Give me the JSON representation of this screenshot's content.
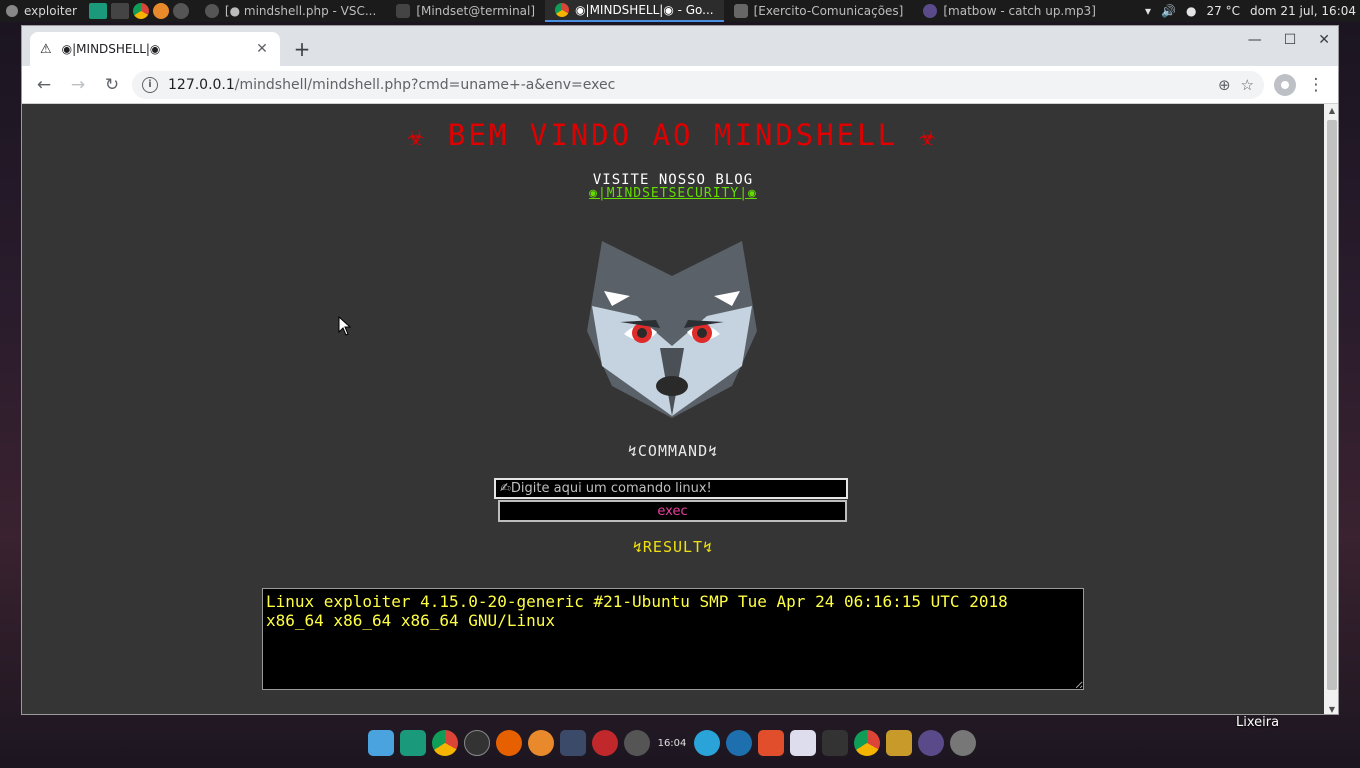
{
  "topbar": {
    "app_name": "exploiter",
    "tasks": [
      {
        "label": "[● mindshell.php - VSC...",
        "active": false
      },
      {
        "label": "[Mindset@terminal]",
        "active": false
      },
      {
        "label": "◉|MINDSHELL|◉ - Go...",
        "active": true
      },
      {
        "label": "[Exercito-Comunicações]",
        "active": false
      },
      {
        "label": "[matbow - catch up.mp3]",
        "active": false
      }
    ],
    "temperature": "27 °C",
    "datetime": "dom 21 jul, 16:04"
  },
  "browser": {
    "tab_title": "◉|MINDSHELL|◉",
    "url_host": "127.0.0.1",
    "url_rest": "/mindshell/mindshell.php?cmd=uname+-a&env=exec"
  },
  "page": {
    "heading": "☣ BEM VINDO AO MINDSHELL ☣",
    "blog_label": "VISITE NOSSO BLOG",
    "blog_link": "◉|MINDSETSECURITY|◉",
    "command_label": "↯COMMAND↯",
    "command_placeholder": "✍Digite aqui um comando linux!",
    "exec_label": "exec",
    "result_label": "↯RESULT↯",
    "result_output": "Linux exploiter 4.15.0-20-generic #21-Ubuntu SMP Tue Apr 24 06:16:15 UTC 2018\nx86_64 x86_64 x86_64 GNU/Linux"
  },
  "desktop": {
    "trash_label": "Lixeira",
    "dock_clock": "16:04"
  },
  "colors": {
    "heading": "#e00000",
    "blog_link": "#66dd00",
    "result_text": "#ffff44",
    "exec_text": "#e6409e",
    "page_bg": "#353535"
  }
}
